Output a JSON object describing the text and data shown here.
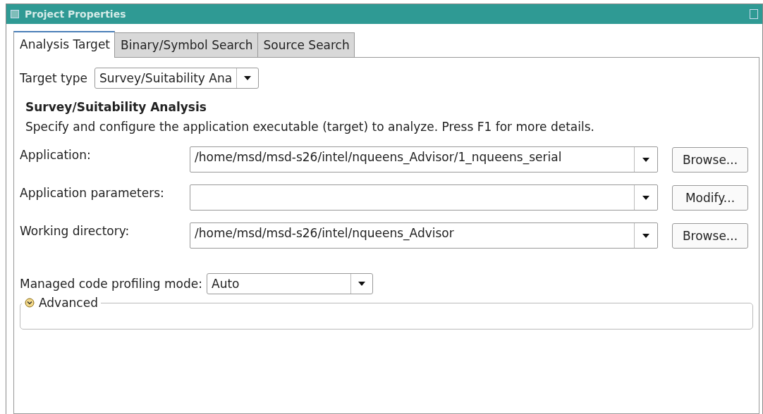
{
  "window": {
    "title": "Project Properties"
  },
  "tabs": [
    {
      "label": "Analysis Target",
      "selected": true
    },
    {
      "label": "Binary/Symbol Search",
      "selected": false
    },
    {
      "label": "Source Search",
      "selected": false
    }
  ],
  "target_type": {
    "label": "Target type",
    "value": "Survey/Suitability Ana"
  },
  "section": {
    "heading": "Survey/Suitability Analysis",
    "description": "Specify and configure the application executable (target) to analyze. Press F1 for more details."
  },
  "fields": [
    {
      "label": "Application:",
      "value": "/home/msd/msd-s26/intel/nqueens_Advisor/1_nqueens_serial",
      "button": "Browse..."
    },
    {
      "label": "Application parameters:",
      "button": "Modify..."
    },
    {
      "label": "Working directory:",
      "value": "/home/msd/msd-s26/intel/nqueens_Advisor",
      "button": "Browse..."
    }
  ],
  "profiling_mode": {
    "label": "Managed code profiling mode:",
    "value": "Auto"
  },
  "advanced": {
    "label": "Advanced",
    "expanded": false
  }
}
